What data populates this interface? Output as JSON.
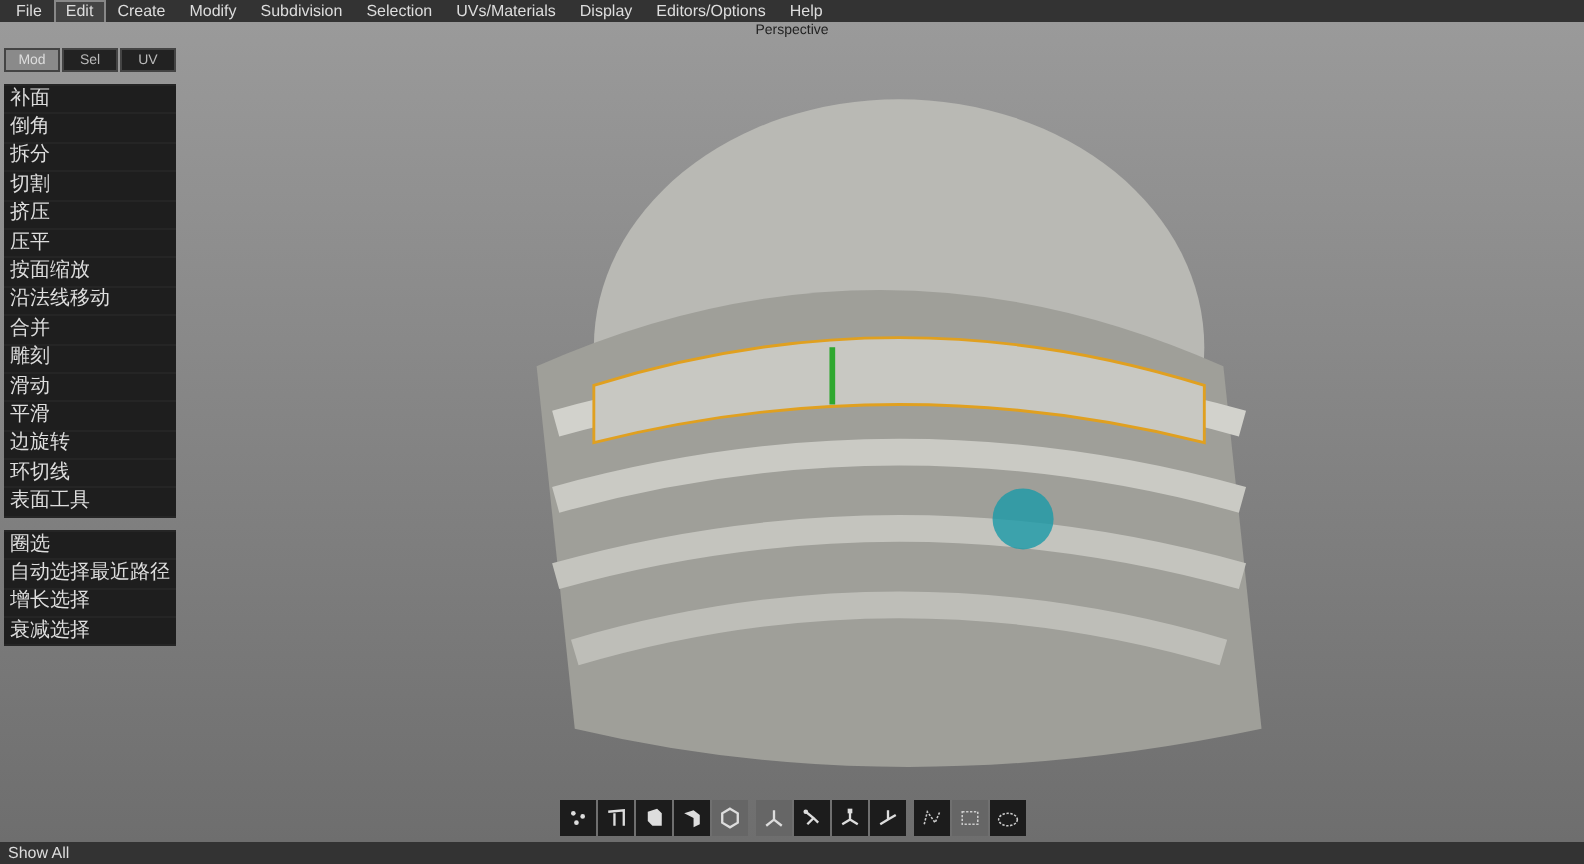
{
  "menu_bar": {
    "items": [
      {
        "label": "File",
        "selected": false
      },
      {
        "label": "Edit",
        "selected": true
      },
      {
        "label": "Create",
        "selected": false
      },
      {
        "label": "Modify",
        "selected": false
      },
      {
        "label": "Subdivision",
        "selected": false
      },
      {
        "label": "Selection",
        "selected": false
      },
      {
        "label": "UVs/Materials",
        "selected": false
      },
      {
        "label": "Display",
        "selected": false
      },
      {
        "label": "Editors/Options",
        "selected": false
      },
      {
        "label": "Help",
        "selected": false
      }
    ]
  },
  "viewport": {
    "title": "Perspective"
  },
  "tool_panel": {
    "tabs": [
      {
        "label": "Mod",
        "selected": true
      },
      {
        "label": "Sel",
        "selected": false
      },
      {
        "label": "UV",
        "selected": false
      }
    ],
    "groups": [
      [
        "补面",
        "倒角",
        "拆分",
        "切割",
        "挤压",
        "压平",
        "按面缩放",
        "沿法线移动",
        "合并",
        "雕刻",
        "滑动",
        "平滑",
        "边旋转",
        "环切线",
        "表面工具"
      ],
      [
        "圈选",
        "自动选择最近路径",
        "增长选择",
        "衰减选择"
      ]
    ]
  },
  "toolbar": {
    "groups": [
      [
        {
          "kind": "vertex",
          "selected": false
        },
        {
          "kind": "edge",
          "selected": false
        },
        {
          "kind": "face",
          "selected": false
        },
        {
          "kind": "object",
          "selected": false
        },
        {
          "kind": "hexagon",
          "selected": true
        }
      ],
      [
        {
          "kind": "gizmo",
          "selected": true
        },
        {
          "kind": "rotate",
          "selected": false
        },
        {
          "kind": "scale",
          "selected": false
        },
        {
          "kind": "world",
          "selected": false
        }
      ],
      [
        {
          "kind": "lasso",
          "selected": false
        },
        {
          "kind": "rect",
          "selected": true
        },
        {
          "kind": "paint",
          "selected": false
        }
      ]
    ]
  },
  "status_bar": {
    "text": "Show All"
  }
}
